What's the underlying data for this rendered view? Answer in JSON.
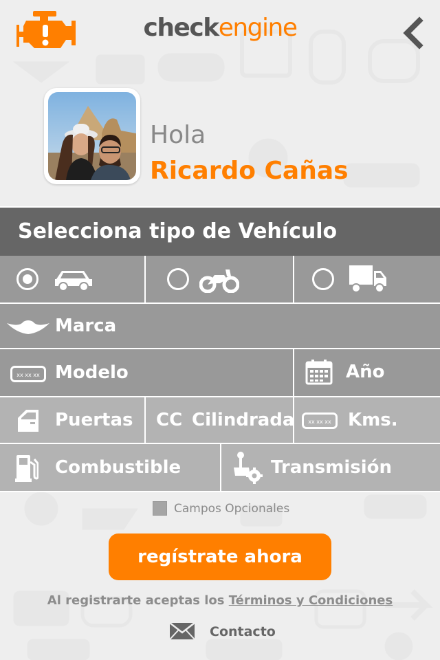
{
  "header": {
    "brand_part1": "check",
    "brand_part2": "engine",
    "logo_icon": "engine-warning-icon",
    "back_icon": "chevron-left-icon",
    "colors": {
      "accent": "#ff7f00",
      "dark": "#555555"
    }
  },
  "profile": {
    "greeting": "Hola",
    "name": "Ricardo Cañas"
  },
  "vehicle_section": {
    "title": "Selecciona tipo de Vehículo",
    "types": [
      {
        "icon": "car-icon",
        "selected": true
      },
      {
        "icon": "motorcycle-icon",
        "selected": false
      },
      {
        "icon": "truck-icon",
        "selected": false
      }
    ]
  },
  "fields": {
    "marca": "Marca",
    "modelo": "Modelo",
    "anio": "Año",
    "puertas": "Puertas",
    "cc_prefix": "CC",
    "cilindrada": "Cilindrada",
    "kms": "Kms.",
    "combustible": "Combustible",
    "transmision": "Transmisión",
    "plate_text": "xx xx xx"
  },
  "optional": {
    "label": "Campos Opcionales",
    "checked": false
  },
  "register_button": "regístrate ahora",
  "terms": {
    "prefix": "Al registrarte aceptas los",
    "link": "Términos y Condiciones"
  },
  "contact": {
    "label": "Contacto",
    "icon": "envelope-icon"
  }
}
